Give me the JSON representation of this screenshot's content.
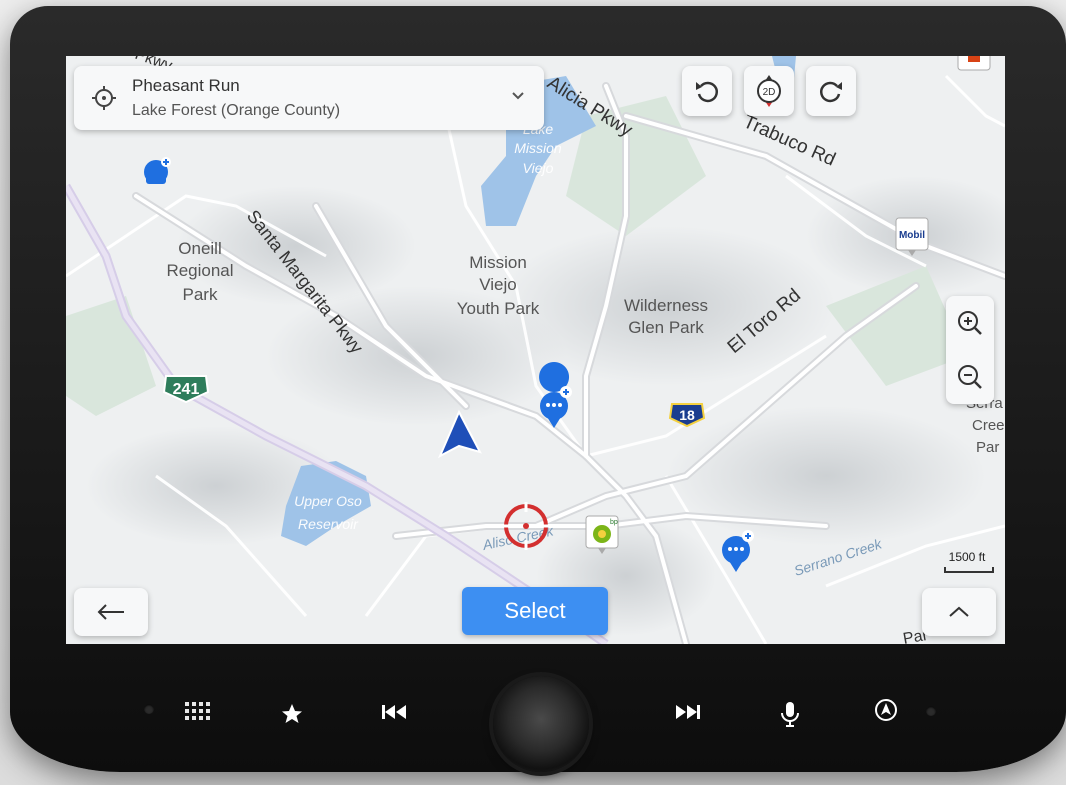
{
  "location": {
    "title": "Pheasant Run",
    "subtitle": "Lake Forest (Orange County)"
  },
  "toolbar": {
    "compass_label": "2D"
  },
  "map": {
    "labels": {
      "alicia": "Alicia Pkwy",
      "trabuco": "Trabuco Rd",
      "santa_margarita": "Santa Margarita Pkwy",
      "oneill": [
        "Oneill",
        "Regional",
        "Park"
      ],
      "mission_park": [
        "Mission",
        "Viejo",
        "Youth Park"
      ],
      "wilderness": [
        "Wilderness",
        "Glen Park"
      ],
      "el_toro": "El Toro Rd",
      "lake_mission": [
        "Lake",
        "Mission",
        "Viejo"
      ],
      "upper_oso": [
        "Upper Oso",
        "Reservoir"
      ],
      "aliso": "Aliso Creek",
      "serrano": "Serrano Creek",
      "serrano_park": [
        "Serra",
        "Cree",
        "Par"
      ],
      "pkwy_fragment": "Pkwy",
      "par_fragment": "Par"
    },
    "shields": {
      "sr241": "241",
      "sr18": "18"
    },
    "poi": {
      "mobil": "Mobil",
      "bp": "bp"
    }
  },
  "scale": {
    "label": "1500 ft"
  },
  "buttons": {
    "select": "Select"
  },
  "colors": {
    "accent": "#3d8ff2",
    "vehicle": "#1f4fb8",
    "target": "#d32f2f"
  }
}
